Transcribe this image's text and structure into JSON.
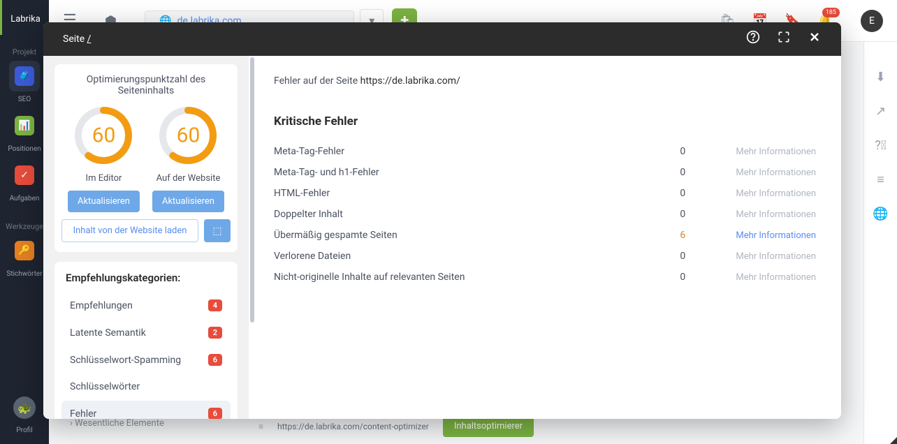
{
  "app": {
    "logo": "Labrika"
  },
  "nav": {
    "section_project": "Projekt",
    "seo": "SEO",
    "positions": "Positionen",
    "tasks": "Aufgaben",
    "section_tools": "Werkzeuge",
    "keywords": "Stichwörter",
    "profile": "Profil"
  },
  "topbar": {
    "url": "de.labrika.com",
    "notif_count": "185",
    "avatar_letter": "E"
  },
  "bg": {
    "sidebar_item": "Wesentliche Elemente",
    "bottom_url": "https://de.labrika.com/content-optimizer",
    "bottom_btn": "Inhaltsoptimierer"
  },
  "modal": {
    "title_prefix": "Seite ",
    "title_path": "/",
    "score": {
      "heading": "Optimierungspunktzahl des Seiteninhalts",
      "editor_value": "60",
      "website_value": "60",
      "editor_label": "Im Editor",
      "website_label": "Auf der Website",
      "refresh": "Aktualisieren",
      "load_content": "Inhalt von der Website laden"
    },
    "categories": {
      "heading": "Empfehlungskategorien:",
      "items": [
        {
          "label": "Empfehlungen",
          "badge": "4",
          "active": false
        },
        {
          "label": "Latente Semantik",
          "badge": "2",
          "active": false
        },
        {
          "label": "Schlüsselwort-Spamming",
          "badge": "6",
          "active": false
        },
        {
          "label": "Schlüsselwörter",
          "badge": "",
          "active": false
        },
        {
          "label": "Fehler",
          "badge": "6",
          "active": true
        }
      ]
    },
    "errors": {
      "intro_prefix": "Fehler auf der Seite ",
      "url": "https://de.labrika.com/",
      "heading": "Kritische Fehler",
      "more_info": "Mehr Informationen",
      "rows": [
        {
          "name": "Meta-Tag-Fehler",
          "count": "0",
          "highlight": false
        },
        {
          "name": "Meta-Tag- und h1-Fehler",
          "count": "0",
          "highlight": false
        },
        {
          "name": "HTML-Fehler",
          "count": "0",
          "highlight": false
        },
        {
          "name": "Doppelter Inhalt",
          "count": "0",
          "highlight": false
        },
        {
          "name": "Übermäßig gespamte Seiten",
          "count": "6",
          "highlight": true
        },
        {
          "name": "Verlorene Dateien",
          "count": "0",
          "highlight": false
        },
        {
          "name": "Nicht-originelle Inhalte auf relevanten Seiten",
          "count": "0",
          "highlight": false
        }
      ]
    }
  },
  "chart_data": [
    {
      "type": "pie",
      "title": "Im Editor",
      "values": [
        60,
        40
      ],
      "categories": [
        "score",
        "remaining"
      ],
      "ylim": [
        0,
        100
      ]
    },
    {
      "type": "pie",
      "title": "Auf der Website",
      "values": [
        60,
        40
      ],
      "categories": [
        "score",
        "remaining"
      ],
      "ylim": [
        0,
        100
      ]
    }
  ]
}
